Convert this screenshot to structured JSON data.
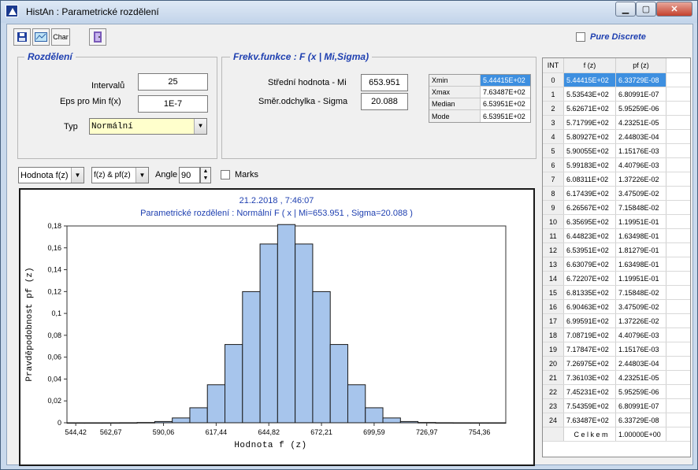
{
  "window": {
    "title": "HistAn :  Parametrické rozdělení"
  },
  "toolbar": {
    "char_label": "Char"
  },
  "pure_discrete": {
    "label": "Pure Discrete",
    "checked": false
  },
  "rozdeleni": {
    "title": "Rozdělení",
    "intervalu_label": "Intervalů",
    "intervalu_value": "25",
    "eps_label": "Eps pro Min f(x)",
    "eps_value": "1E-7",
    "typ_label": "Typ",
    "typ_value": "Normální"
  },
  "frekv": {
    "title": "Frekv.funkce :  F (x | Mi,Sigma)",
    "mi_label": "Střední hodnota - Mi",
    "mi_value": "653.951",
    "sigma_label": "Směr.odchylka - Sigma",
    "sigma_value": "20.088"
  },
  "stats": [
    {
      "key": "Xmin",
      "value": "5.44415E+02"
    },
    {
      "key": "Xmax",
      "value": "7.63487E+02"
    },
    {
      "key": "Median",
      "value": "6.53951E+02"
    },
    {
      "key": "Mode",
      "value": "6.53951E+02"
    }
  ],
  "chart_controls": {
    "hodnota_value": "Hodnota f(z)",
    "fz_value": "f(z) & pf(z)",
    "angle_label": "Angle",
    "angle_value": "90",
    "marks_label": "Marks"
  },
  "table": {
    "headers": [
      "INT",
      "f (z)",
      "pf (z)"
    ],
    "rows": [
      [
        "0",
        "5.44415E+02",
        "6.33729E-08"
      ],
      [
        "1",
        "5.53543E+02",
        "6.80991E-07"
      ],
      [
        "2",
        "5.62671E+02",
        "5.95259E-06"
      ],
      [
        "3",
        "5.71799E+02",
        "4.23251E-05"
      ],
      [
        "4",
        "5.80927E+02",
        "2.44803E-04"
      ],
      [
        "5",
        "5.90055E+02",
        "1.15176E-03"
      ],
      [
        "6",
        "5.99183E+02",
        "4.40796E-03"
      ],
      [
        "7",
        "6.08311E+02",
        "1.37226E-02"
      ],
      [
        "8",
        "6.17439E+02",
        "3.47509E-02"
      ],
      [
        "9",
        "6.26567E+02",
        "7.15848E-02"
      ],
      [
        "10",
        "6.35695E+02",
        "1.19951E-01"
      ],
      [
        "11",
        "6.44823E+02",
        "1.63498E-01"
      ],
      [
        "12",
        "6.53951E+02",
        "1.81279E-01"
      ],
      [
        "13",
        "6.63079E+02",
        "1.63498E-01"
      ],
      [
        "14",
        "6.72207E+02",
        "1.19951E-01"
      ],
      [
        "15",
        "6.81335E+02",
        "7.15848E-02"
      ],
      [
        "16",
        "6.90463E+02",
        "3.47509E-02"
      ],
      [
        "17",
        "6.99591E+02",
        "1.37226E-02"
      ],
      [
        "18",
        "7.08719E+02",
        "4.40796E-03"
      ],
      [
        "19",
        "7.17847E+02",
        "1.15176E-03"
      ],
      [
        "20",
        "7.26975E+02",
        "2.44803E-04"
      ],
      [
        "21",
        "7.36103E+02",
        "4.23251E-05"
      ],
      [
        "22",
        "7.45231E+02",
        "5.95259E-06"
      ],
      [
        "23",
        "7.54359E+02",
        "6.80991E-07"
      ],
      [
        "24",
        "7.63487E+02",
        "6.33729E-08"
      ]
    ],
    "total_label": "C e l k e m",
    "total_value": "1.00000E+00"
  },
  "chart_data": {
    "type": "bar",
    "header_line1": "21.2.2018 , 7:46:07",
    "title": "Parametrické rozdělení : Normální  F ( x |  Mi=653.951 , Sigma=20.088 )",
    "xlabel": "Hodnota   f (z)",
    "ylabel": "Pravděpodobnost   pf (z)",
    "xlim": [
      544.415,
      763.487
    ],
    "ylim": [
      0,
      0.18
    ],
    "x_ticks": [
      "544,42",
      "562,67",
      "590,06",
      "617,44",
      "644,82",
      "672,21",
      "699,59",
      "726,97",
      "754,36"
    ],
    "x_tick_values": [
      544.42,
      562.67,
      590.06,
      617.44,
      644.82,
      672.21,
      699.59,
      726.97,
      754.36
    ],
    "y_ticks": [
      "0",
      "0,02",
      "0,04",
      "0,06",
      "0,08",
      "0,1",
      "0,12",
      "0,14",
      "0,16",
      "0,18"
    ],
    "y_tick_values": [
      0,
      0.02,
      0.04,
      0.06,
      0.08,
      0.1,
      0.12,
      0.14,
      0.16,
      0.18
    ],
    "bin_width": 9.128,
    "x": [
      544.415,
      553.543,
      562.671,
      571.799,
      580.927,
      590.055,
      599.183,
      608.311,
      617.439,
      626.567,
      635.695,
      644.823,
      653.951,
      663.079,
      672.207,
      681.335,
      690.463,
      699.591,
      708.719,
      717.847,
      726.975,
      736.103,
      745.231,
      754.359,
      763.487
    ],
    "values": [
      6.33729e-08,
      6.80991e-07,
      5.95259e-06,
      4.23251e-05,
      0.000244803,
      0.00115176,
      0.00440796,
      0.0137226,
      0.0347509,
      0.0715848,
      0.119951,
      0.163498,
      0.181279,
      0.163498,
      0.119951,
      0.0715848,
      0.0347509,
      0.0137226,
      0.00440796,
      0.00115176,
      0.000244803,
      4.23251e-05,
      5.95259e-06,
      6.80991e-07,
      6.33729e-08
    ],
    "bar_color": "#a7c5ec",
    "bar_edge": "#1a1a1a",
    "grid": false
  }
}
